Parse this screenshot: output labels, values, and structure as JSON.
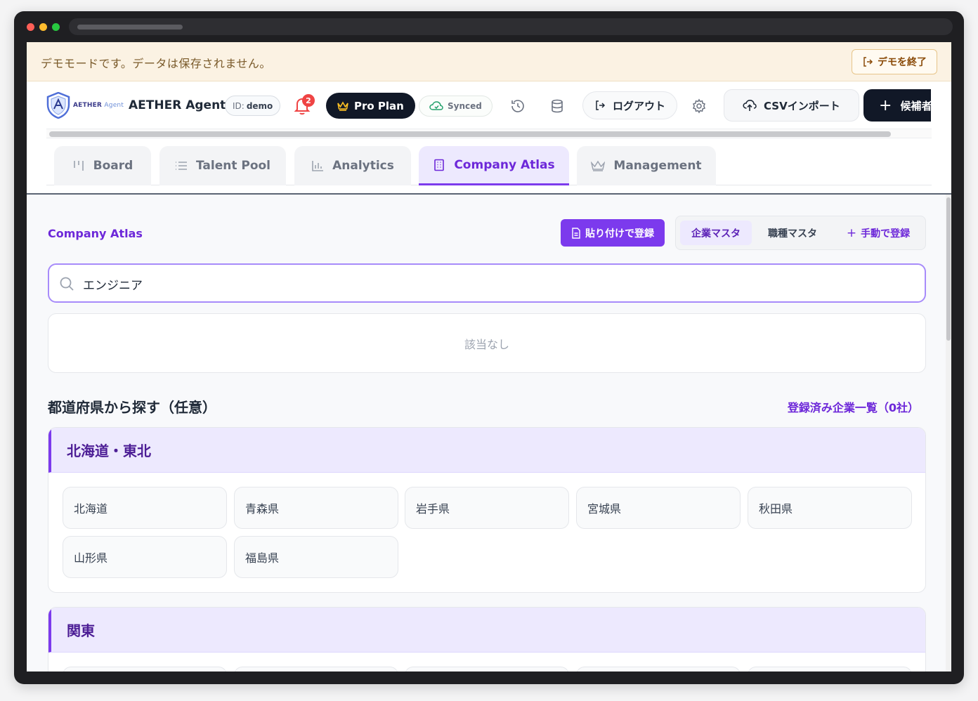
{
  "demo_banner": {
    "message": "デモモードです。データは保存されません。",
    "exit_label": "デモを終了"
  },
  "header": {
    "brand_sub": "AETHER",
    "brand_sub_agent": "Agent",
    "brand_name": "AETHER Agent",
    "id_label": "ID:",
    "id_value": "demo",
    "notification_count": "2",
    "plan_label": "Pro Plan",
    "sync_label": "Synced",
    "logout_label": "ログアウト",
    "csv_label": "CSVインポート",
    "add_candidate_label": "候補者"
  },
  "tabs": [
    {
      "label": "Board",
      "icon": "kanban-icon"
    },
    {
      "label": "Talent Pool",
      "icon": "list-icon"
    },
    {
      "label": "Analytics",
      "icon": "bar-chart-icon"
    },
    {
      "label": "Company Atlas",
      "icon": "building-icon",
      "active": true
    },
    {
      "label": "Management",
      "icon": "crown-icon"
    }
  ],
  "atlas": {
    "title": "Company Atlas",
    "paste_register_label": "貼り付けで登録",
    "segment_company_master": "企業マスタ",
    "segment_job_master": "職種マスタ",
    "segment_manual_register": "手動で登録",
    "search_value": "エンジニア",
    "empty_message": "該当なし",
    "prefecture_title": "都道府県から探す（任意）",
    "registered_link": "登録済み企業一覧（0社）"
  },
  "regions": [
    {
      "name": "北海道・東北",
      "prefectures": [
        "北海道",
        "青森県",
        "岩手県",
        "宮城県",
        "秋田県",
        "山形県",
        "福島県"
      ]
    },
    {
      "name": "関東",
      "prefectures": []
    }
  ],
  "colors": {
    "accent": "#7c3aed",
    "accent_light": "#ede9fe",
    "dark_button": "#111827",
    "demo_banner": "#fbf2e3",
    "notification": "#ef4444"
  }
}
